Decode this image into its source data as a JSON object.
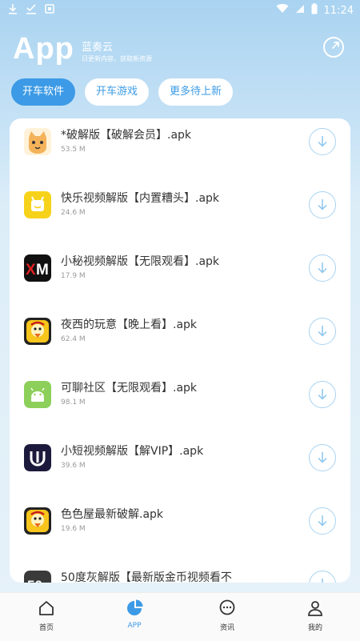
{
  "status_bar": {
    "time": "11:24",
    "left_icons": [
      "download-icon",
      "check-download-icon",
      "media-icon"
    ],
    "right_icons": [
      "wifi-icon",
      "sim-icon",
      "battery-icon"
    ]
  },
  "header": {
    "title": "App",
    "subtitle": "蓝奏云",
    "tagline": "日更新内容，获取新资源",
    "share_icon": "share-icon"
  },
  "tabs": [
    {
      "label": "开车软件",
      "active": true
    },
    {
      "label": "开车游戏",
      "active": false
    },
    {
      "label": "更多待上新",
      "active": false
    }
  ],
  "apps": [
    {
      "name": "*破解版【破解会员】.apk",
      "size": "53.5 M",
      "icon": "cat-icon"
    },
    {
      "name": "快乐视频解版【内置糟头】.apk",
      "size": "24.6 M",
      "icon": "yellow-app-icon"
    },
    {
      "name": "小秘视频解版【无限观看】.apk",
      "size": "17.9 M",
      "icon": "xm-logo-icon"
    },
    {
      "name": "夜西的玩意【晚上看】.apk",
      "size": "62.4 M",
      "icon": "duck-icon"
    },
    {
      "name": "可聊社区【无限观看】.apk",
      "size": "98.1 M",
      "icon": "android-icon"
    },
    {
      "name": "小短视频解版【解VIP】.apk",
      "size": "39.6 M",
      "icon": "u-logo-icon"
    },
    {
      "name": "色色屋最新破解.apk",
      "size": "19.6 M",
      "icon": "duck-icon"
    },
    {
      "name": "50度灰解版【最新版金币视频看不",
      "size": "",
      "icon": "fifty-icon"
    }
  ],
  "bottom_nav": [
    {
      "label": "首页",
      "icon": "home-icon",
      "active": false
    },
    {
      "label": "APP",
      "icon": "pie-chart-icon",
      "active": true
    },
    {
      "label": "资讯",
      "icon": "chat-bubble-icon",
      "active": false
    },
    {
      "label": "我的",
      "icon": "person-icon",
      "active": false
    }
  ],
  "colors": {
    "accent": "#3c9ae6",
    "download_ring": "#a7d3f2"
  }
}
